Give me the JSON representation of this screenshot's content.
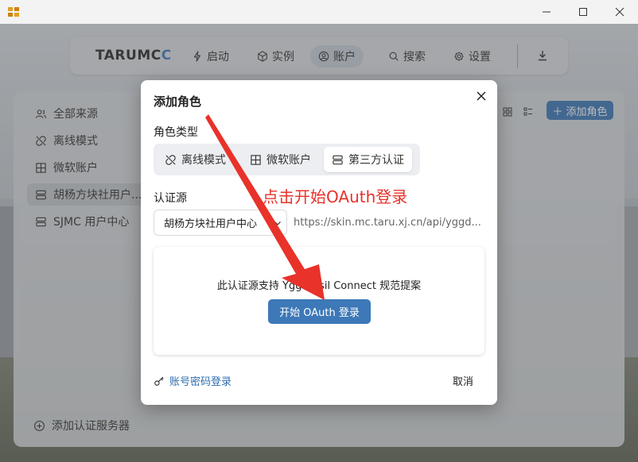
{
  "window": {
    "controls": [
      "minimize",
      "maximize",
      "close"
    ]
  },
  "navbar": {
    "brand_main": "TARUMC",
    "brand_accent": "C",
    "items": [
      {
        "label": "启动",
        "icon": "rocket-icon"
      },
      {
        "label": "实例",
        "icon": "cube-icon"
      },
      {
        "label": "账户",
        "icon": "user-circle-icon",
        "active": true
      },
      {
        "label": "搜索",
        "icon": "search-icon"
      },
      {
        "label": "设置",
        "icon": "gear-icon"
      }
    ]
  },
  "sidebar": {
    "items": [
      {
        "label": "全部来源",
        "icon": "users-icon"
      },
      {
        "label": "离线模式",
        "icon": "link-off-icon"
      },
      {
        "label": "微软账户",
        "icon": "microsoft-icon"
      },
      {
        "label": "胡杨方块社用户...",
        "icon": "server-icon",
        "active": true
      },
      {
        "label": "SJMC 用户中心",
        "icon": "server-icon"
      }
    ],
    "add_label": "添加认证服务器"
  },
  "toolbar": {
    "add_role_label": "添加角色"
  },
  "modal": {
    "title": "添加角色",
    "role_type_label": "角色类型",
    "role_types": [
      {
        "label": "离线模式",
        "icon": "link-off-icon"
      },
      {
        "label": "微软账户",
        "icon": "microsoft-icon"
      },
      {
        "label": "第三方认证",
        "icon": "server-icon",
        "selected": true
      }
    ],
    "source_label": "认证源",
    "source_value": "胡杨方块社用户中心",
    "source_url": "https://skin.mc.taru.xj.cn/api/yggd...",
    "oauth_desc": "此认证源支持 Yggdrasil Connect 规范提案",
    "oauth_button": "开始 OAuth 登录",
    "password_login": "账号密码登录",
    "cancel": "取消"
  },
  "annotation": {
    "text": "点击开始OAuth登录",
    "color": "#e8322a"
  },
  "colors": {
    "accent": "#3d78b8",
    "link": "#2f6cae"
  }
}
